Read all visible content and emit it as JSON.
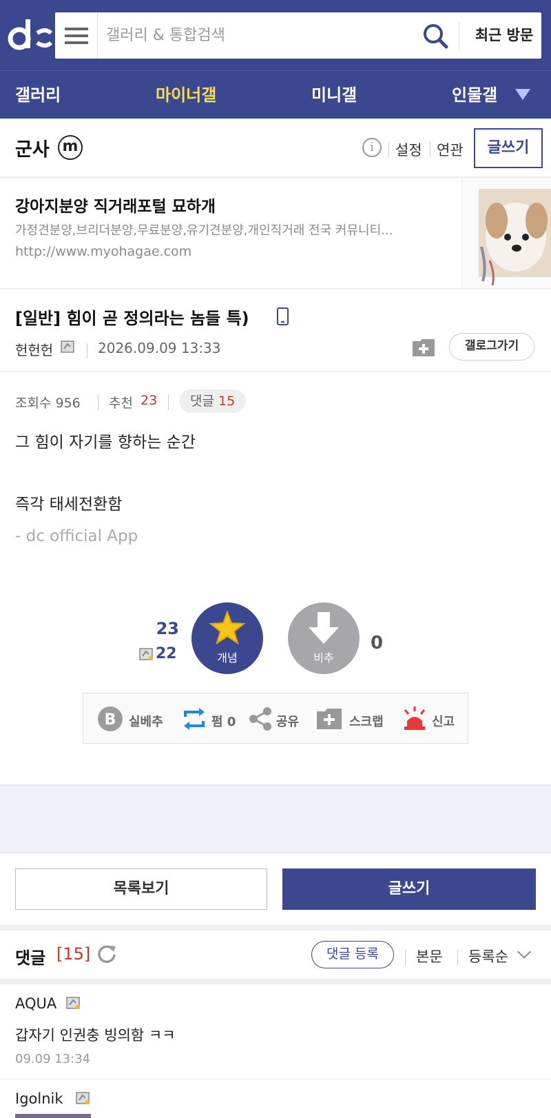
{
  "header": {
    "logo_icon": "dc-logo-icon",
    "menu_icon": "hamburger-icon",
    "search_placeholder": "갤러리 & 통합검색",
    "search_icon": "search-icon",
    "recent_label": "최근 방문",
    "brand_color": "#3b4890"
  },
  "nav": {
    "items": [
      {
        "label": "갤러리",
        "active": false
      },
      {
        "label": "마이너갤",
        "active": true
      },
      {
        "label": "미니갤",
        "active": false
      },
      {
        "label": "인물갤",
        "active": false
      }
    ],
    "active_color": "#f6e04a"
  },
  "gallery": {
    "title": "군사",
    "badge": "m",
    "info_icon": "info-icon",
    "settings_label": "설정",
    "related_label": "연관",
    "write_label": "글쓰기"
  },
  "ad": {
    "title": "강아지분양 직거래포털 묘하개",
    "description": "가정견분양,브리더분양,무료분양,유기견분양,개인직거래 전국 커뮤니티...",
    "url": "http://www.myohagae.com"
  },
  "post": {
    "title": "[일반] 힘이 곧 정의라는 놈들 특)",
    "author": "헌헌헌",
    "date": "2026.09.09 13:33",
    "gallog_label": "갤로그가기",
    "views_label": "조회수 956",
    "recommend_label": "추천",
    "recommend_count": "23",
    "comments_label": "댓글",
    "comments_count": "15",
    "body_lines": [
      "그 힘이 자기를 향하는 순간",
      "즉각 태세전환함"
    ],
    "app_signature": "- dc official App"
  },
  "vote": {
    "up_count": "23",
    "fixed_up_count": "22",
    "up_label": "개념",
    "down_label": "비추",
    "down_count": "0"
  },
  "actions": {
    "best_label": "실베추",
    "repost_label": "펌 0",
    "share_label": "공유",
    "scrap_label": "스크랩",
    "report_label": "신고"
  },
  "buttons": {
    "list_label": "목록보기",
    "write_label": "글쓰기"
  },
  "comments": {
    "title": "댓글",
    "count": "[15]",
    "register_label": "댓글 등록",
    "body_link": "본문",
    "sort_label": "등록순",
    "items": [
      {
        "author": "AQUA",
        "text": "갑자기 인권충 빙의함 ㅋㅋ",
        "date": "09.09 13:34"
      },
      {
        "author": "Igolnik",
        "text": "",
        "date": ""
      }
    ]
  }
}
